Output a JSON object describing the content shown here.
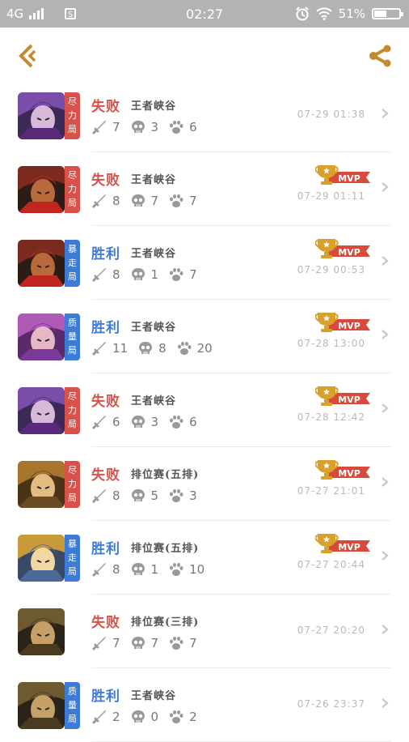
{
  "status_bar": {
    "network": "4G",
    "time": "02:27",
    "battery": "51%",
    "battery_level": 0.51
  },
  "colors": {
    "accent": "#c58a2c",
    "lose": "#d6524a",
    "win": "#3d7bd6",
    "tag_red": "#d6524a",
    "tag_blue": "#3d7bd6"
  },
  "matches": [
    {
      "result": "失败",
      "outcome": "lose",
      "mode": "王者峡谷",
      "tag": "尽力局",
      "tag_color": "red",
      "kills": "7",
      "deaths": "3",
      "assists": "6",
      "time": "07-29 01:38",
      "mvp": false,
      "hero": "hero-a"
    },
    {
      "result": "失败",
      "outcome": "lose",
      "mode": "王者峡谷",
      "tag": "尽力局",
      "tag_color": "red",
      "kills": "8",
      "deaths": "7",
      "assists": "7",
      "time": "07-29 01:11",
      "mvp": true,
      "hero": "hero-b"
    },
    {
      "result": "胜利",
      "outcome": "win",
      "mode": "王者峡谷",
      "tag": "暴走局",
      "tag_color": "blue",
      "kills": "8",
      "deaths": "1",
      "assists": "7",
      "time": "07-29 00:53",
      "mvp": true,
      "hero": "hero-b"
    },
    {
      "result": "胜利",
      "outcome": "win",
      "mode": "王者峡谷",
      "tag": "质量局",
      "tag_color": "blue",
      "kills": "11",
      "deaths": "8",
      "assists": "20",
      "time": "07-28 13:00",
      "mvp": true,
      "hero": "hero-c"
    },
    {
      "result": "失败",
      "outcome": "lose",
      "mode": "王者峡谷",
      "tag": "尽力局",
      "tag_color": "red",
      "kills": "6",
      "deaths": "3",
      "assists": "6",
      "time": "07-28 12:42",
      "mvp": true,
      "hero": "hero-a"
    },
    {
      "result": "失败",
      "outcome": "lose",
      "mode": "排位赛(五排)",
      "tag": "尽力局",
      "tag_color": "red",
      "kills": "8",
      "deaths": "5",
      "assists": "3",
      "time": "07-27 21:01",
      "mvp": true,
      "hero": "hero-d"
    },
    {
      "result": "胜利",
      "outcome": "win",
      "mode": "排位赛(五排)",
      "tag": "暴走局",
      "tag_color": "blue",
      "kills": "8",
      "deaths": "1",
      "assists": "10",
      "time": "07-27 20:44",
      "mvp": true,
      "hero": "hero-e"
    },
    {
      "result": "失败",
      "outcome": "lose",
      "mode": "排位赛(三排)",
      "tag": "",
      "tag_color": "",
      "kills": "7",
      "deaths": "7",
      "assists": "7",
      "time": "07-27 20:20",
      "mvp": false,
      "hero": "hero-f"
    },
    {
      "result": "胜利",
      "outcome": "win",
      "mode": "王者峡谷",
      "tag": "质量局",
      "tag_color": "blue",
      "kills": "2",
      "deaths": "0",
      "assists": "2",
      "time": "07-26 23:37",
      "mvp": false,
      "hero": "hero-f"
    }
  ],
  "mvp_label": "MVP",
  "icons": {
    "back": "back-icon",
    "share": "share-icon",
    "kills": "sword-icon",
    "deaths": "skull-icon",
    "assists": "paw-icon",
    "mvp": "trophy-icon",
    "row": "chevron-right-icon"
  }
}
